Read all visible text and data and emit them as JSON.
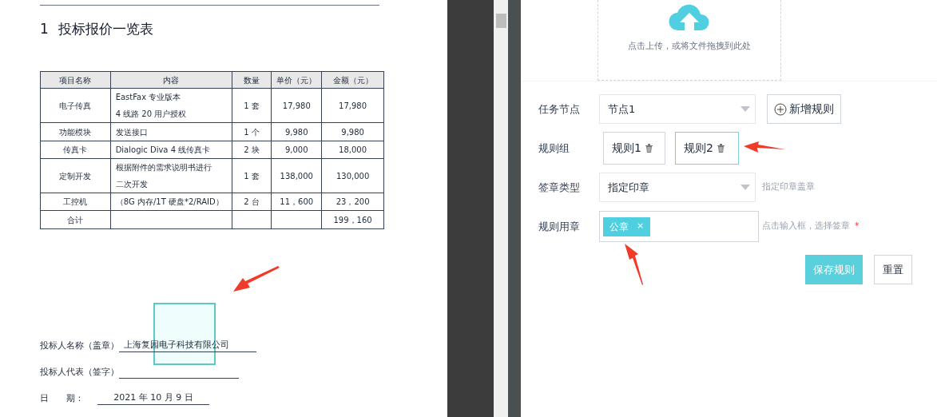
{
  "document": {
    "title_number": "1",
    "title": "投标报价一览表",
    "table": {
      "columns": [
        "项目名称",
        "内容",
        "数量",
        "单价（元）",
        "金额（元）"
      ],
      "rows": [
        {
          "cells": [
            "电子传真",
            [
              "EastFax 专业版本",
              "4 线路 20 用户授权"
            ],
            "1 套",
            "17,980",
            "17,980"
          ]
        },
        {
          "cells": [
            "功能模块",
            "发送接口",
            "1 个",
            "9,980",
            "9,980"
          ]
        },
        {
          "cells": [
            "传真卡",
            "Dialogic Diva 4 线传真卡",
            "2 块",
            "9,000",
            "18,000"
          ]
        },
        {
          "cells": [
            "定制开发",
            [
              "根据附件的需求说明书进行",
              "二次开发"
            ],
            "1 套",
            "138,000",
            "130,000"
          ]
        },
        {
          "cells": [
            "工控机",
            "（8G 内存/1T 硬盘*2/RAID）",
            "2 台",
            "11，600",
            "23，200"
          ]
        },
        {
          "cells": [
            "合计",
            "",
            "",
            "",
            "199，160"
          ]
        }
      ]
    },
    "signatures": [
      {
        "label": "投标人名称（盖章）",
        "value": "上海复园电子科技有限公司"
      },
      {
        "label": "投标人代表（签字）"
      },
      {
        "label": "日　　期：",
        "value": "2021 年 10 月 9 日"
      }
    ]
  },
  "upload": {
    "hint": "点击上传，或将文件拖拽到此处"
  },
  "form": [
    {
      "kind": "select",
      "label": "任务节点",
      "value": "节点1",
      "button": "新增规则"
    },
    {
      "kind": "rules",
      "label": "规则组",
      "rules": [
        {
          "name": "规则1",
          "selected": false
        },
        {
          "name": "规则2",
          "selected": true
        }
      ]
    },
    {
      "kind": "select",
      "label": "签章类型",
      "value": "指定印章",
      "hint": "指定印章盖章"
    },
    {
      "kind": "tags",
      "label": "规则用章",
      "tags": [
        {
          "label": "公章",
          "remove": "×"
        }
      ],
      "hint": "点击输入框，选择签章",
      "required_mark": "*"
    }
  ],
  "actions": [
    {
      "label": "保存规则",
      "primary": true
    },
    {
      "label": "重置",
      "primary": false
    }
  ]
}
